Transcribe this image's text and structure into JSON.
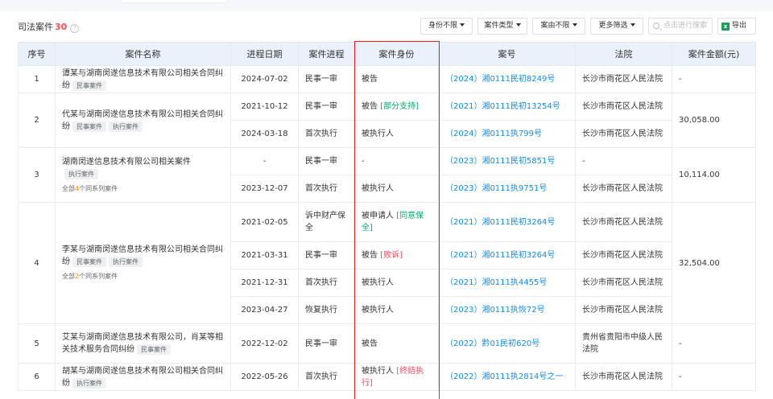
{
  "title": {
    "label": "司法案件",
    "count": "30"
  },
  "toolbar": {
    "role_filter": "身份不限",
    "case_type": "案件类型",
    "cause_filter": "案由不限",
    "more_filter": "更多筛选",
    "search_placeholder": "点击进行搜索",
    "export": "导出"
  },
  "columns": [
    "序号",
    "案件名称",
    "进程日期",
    "案件进程",
    "案件身份",
    "案号",
    "法院",
    "案件金额(元)"
  ],
  "groups": [
    {
      "index": "1",
      "name": "谭某与湖南闵遂信息技术有限公司相关合同纠纷",
      "tags": [
        "民事案件"
      ],
      "series_pre": "",
      "series_count": "",
      "series_post": "",
      "amount": "-",
      "rows": [
        {
          "date": "2024-07-02",
          "stage": "民事一审",
          "role": "被告",
          "role_status": "",
          "status_color": "",
          "case_no": "（2024）湘0111民初8249号",
          "court": "长沙市雨花区人民法院"
        }
      ]
    },
    {
      "index": "2",
      "name": "代某与湖南闵遂信息技术有限公司相关合同纠纷",
      "tags": [
        "民事案件",
        "执行案件"
      ],
      "series_pre": "",
      "series_count": "",
      "series_post": "",
      "amount": "30,058.00",
      "rows": [
        {
          "date": "2021-10-12",
          "stage": "民事一审",
          "role": "被告",
          "role_status": "[部分支持]",
          "status_color": "green",
          "case_no": "（2021）湘0111民初13254号",
          "court": "长沙市雨花区人民法院"
        },
        {
          "date": "2024-03-18",
          "stage": "首次执行",
          "role": "被执行人",
          "role_status": "",
          "status_color": "",
          "case_no": "（2024）湘0111执799号",
          "court": "长沙市雨花区人民法院"
        }
      ]
    },
    {
      "index": "3",
      "name": "湖南闵遂信息技术有限公司相关案件",
      "tags": [
        "执行案件"
      ],
      "series_pre": "全部",
      "series_count": "4",
      "series_post": "个同系列案件",
      "amount": "10,114.00",
      "rows": [
        {
          "date": "-",
          "stage": "民事一审",
          "role": "-",
          "role_status": "",
          "status_color": "",
          "case_no": "（2023）湘0111民初5851号",
          "court": "-"
        },
        {
          "date": "2023-12-07",
          "stage": "首次执行",
          "role": "被执行人",
          "role_status": "",
          "status_color": "",
          "case_no": "（2023）湘0111执9751号",
          "court": "长沙市雨花区人民法院"
        }
      ]
    },
    {
      "index": "4",
      "name": "李某与湖南闵遂信息技术有限公司相关合同纠纷",
      "tags": [
        "民事案件",
        "执行案件"
      ],
      "series_pre": "全部",
      "series_count": "2",
      "series_post": "个同系列案件",
      "amount": "32,504.00",
      "rows": [
        {
          "date": "2021-02-05",
          "stage": "诉中财产保全",
          "role": "被申请人",
          "role_status": "[同意保全]",
          "status_color": "green",
          "case_no": "（2021）湘0111民初3264号",
          "court": "长沙市雨花区人民法院"
        },
        {
          "date": "2021-03-31",
          "stage": "民事一审",
          "role": "被告",
          "role_status": "[败诉]",
          "status_color": "red",
          "case_no": "（2021）湘0111民初3264号",
          "court": "长沙市雨花区人民法院"
        },
        {
          "date": "2021-12-31",
          "stage": "首次执行",
          "role": "被执行人",
          "role_status": "",
          "status_color": "",
          "case_no": "（2021）湘0111执4455号",
          "court": "长沙市雨花区人民法院"
        },
        {
          "date": "2023-04-27",
          "stage": "恢复执行",
          "role": "被执行人",
          "role_status": "",
          "status_color": "",
          "case_no": "（2023）湘0111执恢72号",
          "court": "长沙市雨花区人民法院"
        }
      ]
    },
    {
      "index": "5",
      "name": "艾某与湖南闵遂信息技术有限公司，肖某等相关技术服务合同纠纷",
      "tags": [
        "民事案件"
      ],
      "series_pre": "",
      "series_count": "",
      "series_post": "",
      "amount": "-",
      "rows": [
        {
          "date": "2022-12-02",
          "stage": "民事一审",
          "role": "被告",
          "role_status": "",
          "status_color": "",
          "case_no": "（2022）黔01民初620号",
          "court": "贵州省贵阳市中级人民法院"
        }
      ]
    },
    {
      "index": "6",
      "name": "胡某与湖南闵遂信息技术有限公司相关合同纠纷",
      "tags": [
        "执行案件"
      ],
      "series_pre": "",
      "series_count": "",
      "series_post": "",
      "amount": "-",
      "rows": [
        {
          "date": "2022-05-26",
          "stage": "首次执行",
          "role": "被执行人",
          "role_status": "[终结执行]",
          "status_color": "red",
          "case_no": "（2022）湘0111执2814号之一",
          "court": "长沙市雨花区人民法院"
        }
      ]
    }
  ]
}
